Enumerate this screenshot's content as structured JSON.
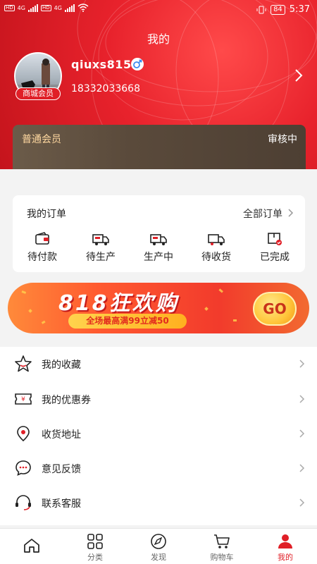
{
  "status_bar": {
    "time": "5:37",
    "battery": "84",
    "network": [
      "HD",
      "4G",
      "HD",
      "4G"
    ]
  },
  "header": {
    "title": "我的"
  },
  "profile": {
    "username": "qiuxs815",
    "phone": "18332033668",
    "badge": "商城会员",
    "gender_icon": "male-icon"
  },
  "membership": {
    "level": "普通会员",
    "status": "审核中"
  },
  "orders": {
    "title": "我的订单",
    "all_label": "全部订单",
    "items": [
      {
        "label": "待付款",
        "icon": "wallet-icon"
      },
      {
        "label": "待生产",
        "icon": "truck-icon"
      },
      {
        "label": "生产中",
        "icon": "truck-icon"
      },
      {
        "label": "待收货",
        "icon": "truck-icon"
      },
      {
        "label": "已完成",
        "icon": "box-check-icon"
      }
    ]
  },
  "banner": {
    "title": "818狂欢购",
    "subtitle": "全场最高满99立减50",
    "cta": "GO"
  },
  "menu": [
    {
      "label": "我的收藏",
      "icon": "star-icon"
    },
    {
      "label": "我的优惠券",
      "icon": "coupon-icon"
    },
    {
      "label": "收货地址",
      "icon": "location-icon"
    },
    {
      "label": "意见反馈",
      "icon": "chat-icon"
    },
    {
      "label": "联系客服",
      "icon": "headset-icon"
    }
  ],
  "tabbar": {
    "active": "我的",
    "items": [
      {
        "label": "",
        "icon": "home-icon"
      },
      {
        "label": "分类",
        "icon": "grid-icon"
      },
      {
        "label": "发现",
        "icon": "compass-icon"
      },
      {
        "label": "购物车",
        "icon": "cart-icon"
      },
      {
        "label": "我的",
        "icon": "user-icon"
      }
    ]
  },
  "colors": {
    "brand_red": "#e01f27",
    "member_gold": "#ffd8a0",
    "member_card": "#5a4a3b"
  }
}
